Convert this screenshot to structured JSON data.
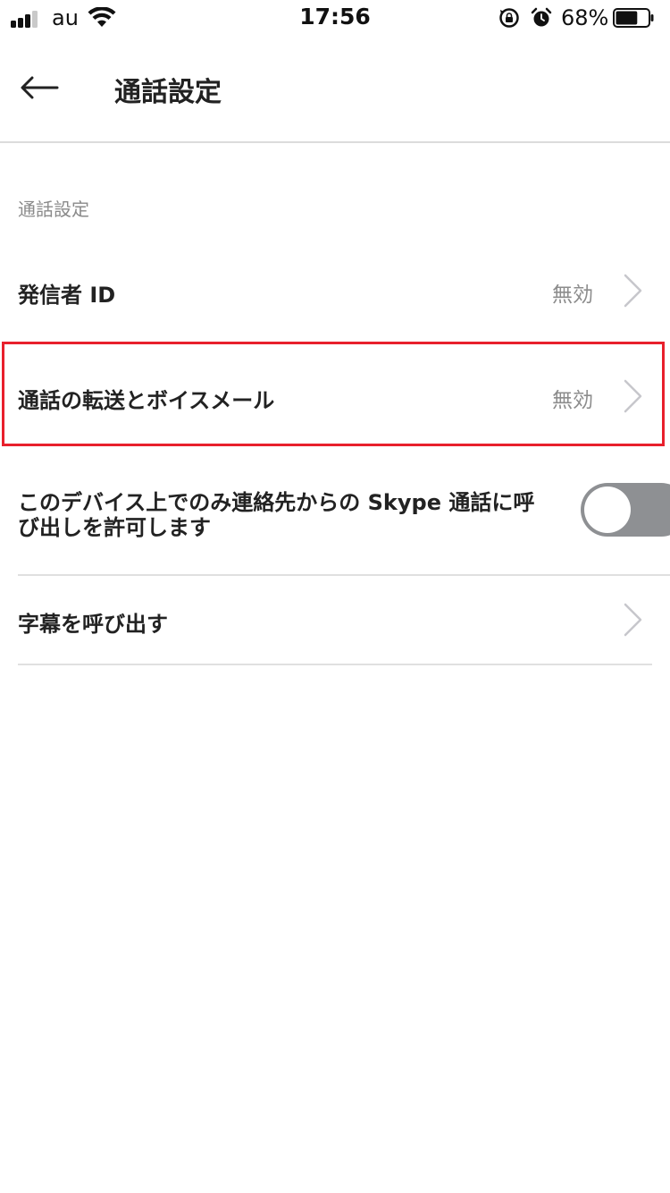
{
  "status_bar": {
    "carrier": "au",
    "time": "17:56",
    "battery_percent": "68%",
    "battery_level": 0.68,
    "signal_bars_active": 3,
    "icons": [
      "signal-icon",
      "wifi-icon",
      "rotation-lock-icon",
      "alarm-icon",
      "battery-icon"
    ]
  },
  "nav": {
    "title": "通話設定",
    "back_icon": "back-arrow-icon"
  },
  "section": {
    "header": "通話設定"
  },
  "rows": [
    {
      "label": "発信者 ID",
      "value": "無効",
      "icon": "chevron-right-icon"
    },
    {
      "label": "通話の転送とボイスメール",
      "value": "無効",
      "icon": "chevron-right-icon",
      "highlighted": true,
      "highlight_color": "#e8202c"
    },
    {
      "label": "このデバイス上でのみ連絡先からの Skype 通話に呼び出しを許可します",
      "toggle_on": false,
      "toggle_color": "#8e9093"
    },
    {
      "label": "字幕を呼び出す",
      "icon": "chevron-right-icon"
    }
  ]
}
